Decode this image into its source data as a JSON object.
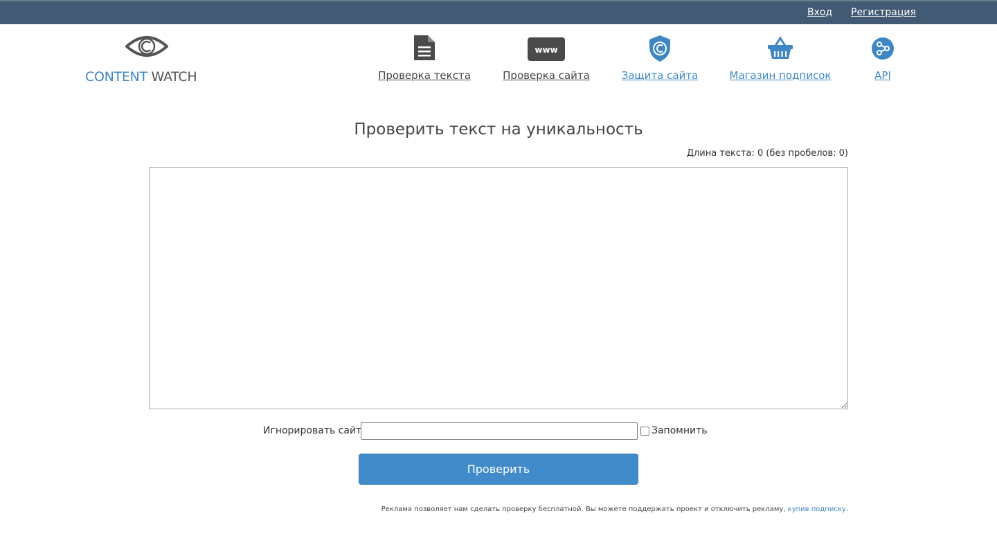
{
  "topbar": {
    "login_label": "Вход",
    "register_label": "Регистрация",
    "background_color": "#425a74"
  },
  "logo": {
    "word1": "CONTENT",
    "word2": " WATCH",
    "icon": "eye-copyright-icon"
  },
  "nav": [
    {
      "label": "Проверка текста",
      "icon": "document-icon"
    },
    {
      "label": "Проверка сайта",
      "icon": "www-icon"
    },
    {
      "label": "Защита сайта",
      "icon": "shield-copyright-icon"
    },
    {
      "label": "Магазин подписок",
      "icon": "basket-icon"
    },
    {
      "label": "API",
      "icon": "api-icon"
    }
  ],
  "main": {
    "title": "Проверить текст на уникальность",
    "length_info": "Длина текста: 0 (без пробелов: 0)",
    "text_value": "",
    "ignore_label": "Игнорировать сайт:",
    "ignore_value": "",
    "remember_label": "Запомнить",
    "remember_checked": false,
    "check_button": "Проверить",
    "ad_note_text": "Реклама позволяет нам сделать проверку бесплатной. Вы можете поддержать проект и отключить рекламу, ",
    "ad_note_link": "купив подписку",
    "ad_note_end": "."
  },
  "colors": {
    "accent": "#428bca",
    "link_blue": "#3f86c4",
    "dark_icon": "#4a4a4a"
  }
}
